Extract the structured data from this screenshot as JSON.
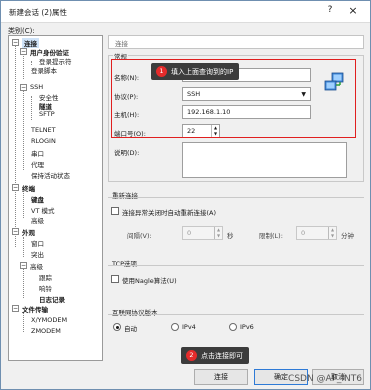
{
  "window": {
    "title": "新建会话 (2)属性",
    "help_glyph": "?",
    "close_glyph": "×"
  },
  "sidebar": {
    "category_label": "类别(C):",
    "items": [
      {
        "label": "连接",
        "bold": true,
        "toggle": "−"
      },
      {
        "label": "用户身份验证",
        "bold": true,
        "toggle": "−"
      },
      {
        "label": "登录提示符",
        "bold": false
      },
      {
        "label": "登录脚本",
        "bold": false
      },
      {
        "label": "SSH",
        "bold": false,
        "toggle": "−"
      },
      {
        "label": "安全性",
        "bold": false
      },
      {
        "label": "隧道",
        "bold": true
      },
      {
        "label": "SFTP",
        "bold": false
      },
      {
        "label": "TELNET",
        "bold": false
      },
      {
        "label": "RLOGIN",
        "bold": false
      },
      {
        "label": "串口",
        "bold": false
      },
      {
        "label": "代理",
        "bold": false
      },
      {
        "label": "保持活动状态",
        "bold": false
      },
      {
        "label": "终端",
        "bold": true,
        "toggle": "−"
      },
      {
        "label": "键盘",
        "bold": true
      },
      {
        "label": "VT 模式",
        "bold": false
      },
      {
        "label": "高级",
        "bold": false
      },
      {
        "label": "外观",
        "bold": true,
        "toggle": "−"
      },
      {
        "label": "窗口",
        "bold": false
      },
      {
        "label": "突出",
        "bold": false
      },
      {
        "label": "高级",
        "bold": false,
        "toggle": "−"
      },
      {
        "label": "跟踪",
        "bold": false
      },
      {
        "label": "响铃",
        "bold": false
      },
      {
        "label": "日志记录",
        "bold": true
      },
      {
        "label": "文件传输",
        "bold": true,
        "toggle": "−"
      },
      {
        "label": "X/YMODEM",
        "bold": false
      },
      {
        "label": "ZMODEM",
        "bold": false
      }
    ]
  },
  "breadcrumb": "连接",
  "general": {
    "title": "常规",
    "name_label": "名称(N):",
    "name_value": "",
    "protocol_label": "协议(P):",
    "protocol_value": "SSH",
    "host_label": "主机(H):",
    "host_value": "192.168.1.10",
    "port_label": "端口号(O):",
    "port_value": "22",
    "desc_label": "说明(D):"
  },
  "reconnect": {
    "title": "重新连接",
    "checkbox_label": "连接异常关闭时自动重新连接(A)",
    "interval_label": "间隔(V):",
    "interval_value": "0",
    "interval_unit": "秒",
    "limit_label": "限制(L):",
    "limit_value": "0",
    "limit_unit": "分钟"
  },
  "tcp": {
    "title": "TCP选项",
    "nagle_label": "使用Nagle算法(U)"
  },
  "ipver": {
    "title": "互联网协议版本",
    "options": [
      "自动",
      "IPv4",
      "IPv6"
    ],
    "selected": "自动"
  },
  "callouts": {
    "one_num": "1",
    "one_text": "填入上面查询到的IP",
    "two_num": "2",
    "two_text": "点击连接即可"
  },
  "buttons": {
    "connect": "连接",
    "ok": "确定",
    "cancel": "取消"
  },
  "watermark": "CSDN @AF_INT6",
  "colors": {
    "highlight_red": "#e01f1f",
    "callout_bg": "#3c3c3c",
    "callout_badge": "#e52b2b",
    "primary_border": "#2e7ad6"
  }
}
